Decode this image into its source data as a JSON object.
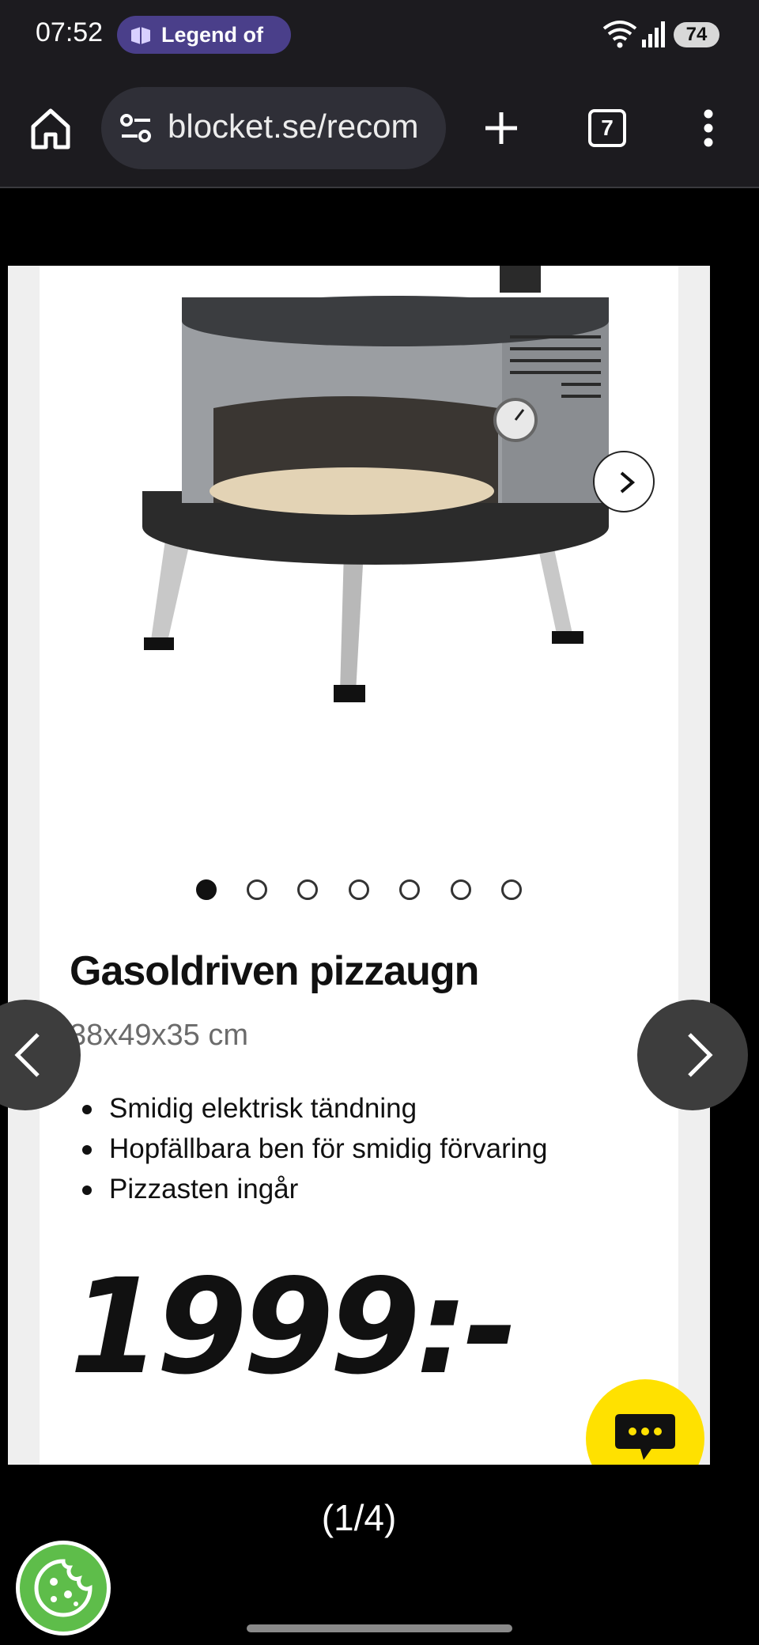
{
  "status_bar": {
    "time": "07:52",
    "notification": "Legend of",
    "battery": "74",
    "icons": [
      "wifi-icon",
      "signal-icon"
    ]
  },
  "browser": {
    "url": "blocket.se/recom",
    "tab_count": "7",
    "icons": [
      "home-icon",
      "tune-icon",
      "plus-icon",
      "more-vert-icon"
    ]
  },
  "product": {
    "title": "Gasoldriven pizzaugn",
    "dimensions": "38x49x35 cm",
    "features": [
      "Smidig elektrisk tändning",
      "Hopfällbara ben för smidig förvaring",
      "Pizzasten ingår"
    ],
    "price": "1999:-",
    "image_dots": {
      "total": 7,
      "active_index": 0
    }
  },
  "viewer": {
    "page_counter": "(1/4)"
  },
  "colors": {
    "chat_button": "#ffe100",
    "cookie_button": "#5ebd4a",
    "browser_bar": "#1c1b1f",
    "notification_pill": "#4a3f8a"
  }
}
